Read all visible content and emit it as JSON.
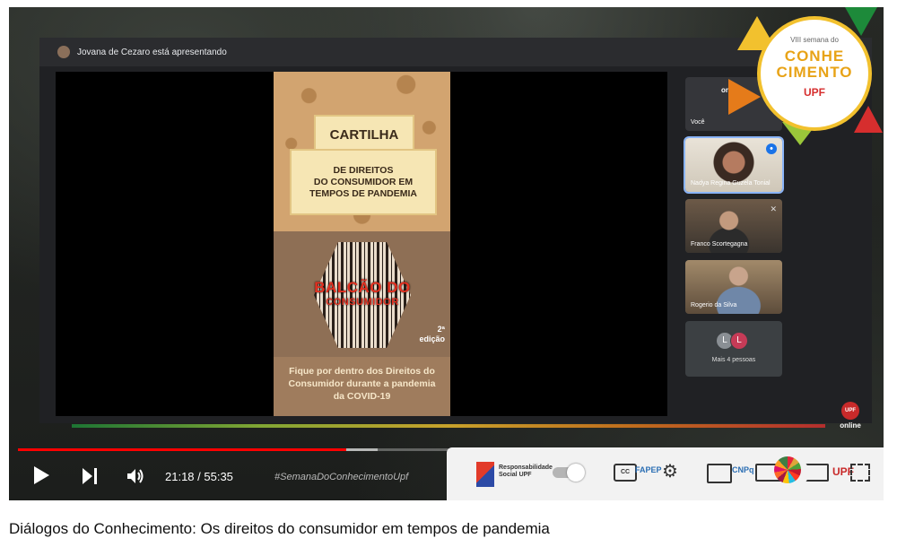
{
  "meet": {
    "presenter_text": "Jovana de Cezaro está apresentando",
    "tiles": [
      {
        "name": "Você",
        "label_logo": "online"
      },
      {
        "name": "Nadya Regina Guzela Tonial"
      },
      {
        "name": "Franco Scortegagna"
      },
      {
        "name": "Rogerio da Silva"
      }
    ],
    "more": {
      "avatars": [
        "L",
        "L"
      ],
      "label": "Mais 4 pessoas"
    }
  },
  "poster": {
    "title": "CARTILHA",
    "subtitle_lines": [
      "DE DIREITOS",
      "DO CONSUMIDOR EM",
      "TEMPOS DE PANDEMIA"
    ],
    "brand_line1": "BALCÃO DO",
    "brand_line2": "CONSUMIDOR",
    "edition_line1": "2ª",
    "edition_line2": "edição",
    "footer_lines": [
      "Fique por dentro dos Direitos do",
      "Consumidor durante a pandemia",
      "da COVID-19"
    ]
  },
  "event_badge": {
    "small": "VIII semana do",
    "big_line1": "CONHE",
    "big_line2": "CIMENTO",
    "upf": "UPF"
  },
  "online_logo": {
    "upf": "UPF",
    "text": "online"
  },
  "player": {
    "current_time": "21:18",
    "duration": "55:35",
    "time_text": "21:18 / 55:35",
    "progress_fraction": 0.383,
    "buffered_fraction": 0.42,
    "hashtag": "#SemanaDoConhecimentoUpf"
  },
  "sponsors": {
    "rs_line1": "Responsabilidade",
    "rs_line2": "Social UPF",
    "fapesp": "FAPEP",
    "cnpq": "CNPq",
    "upf": "UPF"
  },
  "video": {
    "title": "Diálogos do Conhecimento: Os direitos do consumidor em tempos de pandemia"
  },
  "colors": {
    "progress": "#ff0000",
    "brand_red": "#c82a2a",
    "event_yellow": "#f2c12e"
  }
}
